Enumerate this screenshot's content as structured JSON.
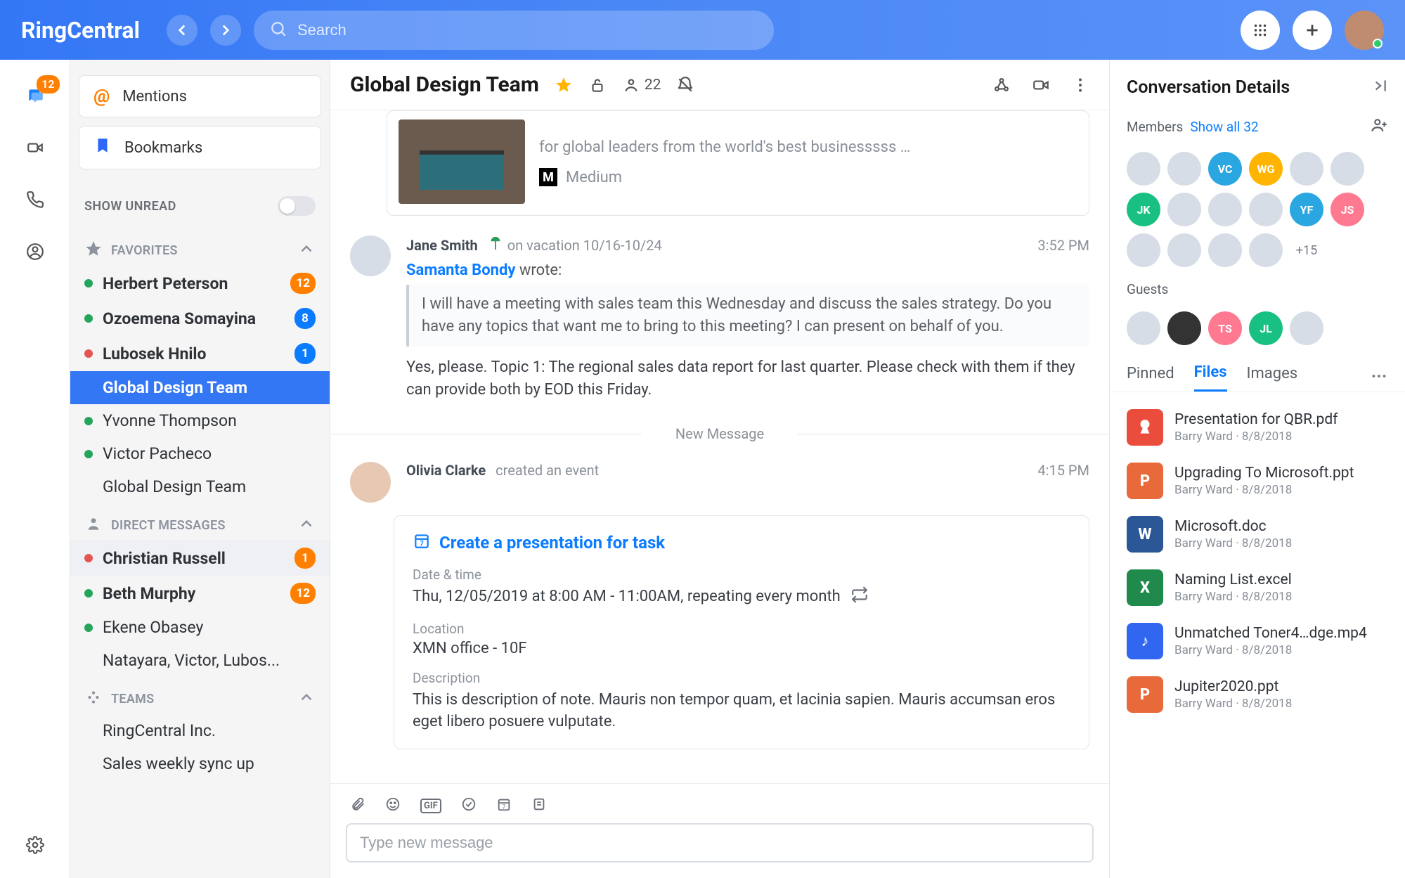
{
  "brand": "RingCentral",
  "search": {
    "placeholder": "Search"
  },
  "rail": {
    "messages_badge": "12"
  },
  "sidebar": {
    "mentions": "Mentions",
    "bookmarks": "Bookmarks",
    "show_unread": "SHOW UNREAD",
    "favorites_label": "FAVORITES",
    "dm_label": "DIRECT MESSAGES",
    "teams_label": "TEAMS",
    "favorites": [
      {
        "name": "Herbert Peterson",
        "dot": "green",
        "badge": "12",
        "badge_color": "orange",
        "unread": true
      },
      {
        "name": "Ozoemena Somayina",
        "dot": "green",
        "badge": "8",
        "badge_color": "blue",
        "unread": true
      },
      {
        "name": "Lubosek Hnilo",
        "dot": "red",
        "badge": "1",
        "badge_color": "blue",
        "unread": true
      },
      {
        "name": "Global Design Team",
        "dot": "none",
        "active": true,
        "unread": true
      },
      {
        "name": "Yvonne Thompson",
        "dot": "green"
      },
      {
        "name": "Victor Pacheco",
        "dot": "green"
      },
      {
        "name": "Global Design Team",
        "dot": "none"
      }
    ],
    "dms": [
      {
        "name": "Christian Russell",
        "dot": "red",
        "badge": "1",
        "badge_color": "orange",
        "unread": true,
        "highlight": true
      },
      {
        "name": "Beth Murphy",
        "dot": "green",
        "badge": "12",
        "badge_color": "orange",
        "unread": true
      },
      {
        "name": "Ekene Obasey",
        "dot": "green"
      },
      {
        "name": "Natayara, Victor, Lubos...",
        "dot": "none"
      }
    ],
    "teams": [
      {
        "name": "RingCentral Inc."
      },
      {
        "name": "Sales weekly sync up"
      }
    ]
  },
  "header": {
    "title": "Global Design Team",
    "member_count": "22"
  },
  "preview": {
    "text": "for global leaders from the world's best businesssss …",
    "source": "Medium"
  },
  "msg1": {
    "author": "Jane Smith",
    "status": "on vacation 10/16-10/24",
    "time": "3:52 PM",
    "quote_author": "Samanta Bondy",
    "quote_wrote": " wrote:",
    "quote": "I will have a meeting with sales team this Wednesday and discuss the sales strategy.  Do you have any topics that want me to bring to this meeting? I can present on behalf of you.",
    "reply": "Yes, please.  Topic 1: The regional sales data report for last quarter.  Please check with them if they can provide both by EOD this Friday."
  },
  "new_msg_divider": "New Message",
  "msg2": {
    "author": "Olivia Clarke",
    "action": "created an event",
    "time": "4:15 PM",
    "event_title": "Create a presentation for task",
    "labels": {
      "datetime": "Date & time",
      "location": "Location",
      "desc": "Description"
    },
    "datetime": "Thu, 12/05/2019 at 8:00 AM - 11:00AM, repeating every month",
    "location": "XMN office - 10F",
    "desc": "This is description of note. Mauris non tempor quam, et lacinia sapien. Mauris accumsan eros eget libero posuere vulputate."
  },
  "composer": {
    "placeholder": "Type new message"
  },
  "details": {
    "title": "Conversation Details",
    "members_label": "Members",
    "show_all": "Show all 32",
    "plus_count": "+15",
    "guests_label": "Guests",
    "tabs": {
      "pinned": "Pinned",
      "files": "Files",
      "images": "Images"
    },
    "files": [
      {
        "name": "Presentation for QBR.pdf",
        "meta": "Barry Ward  ·  8/8/2018",
        "kind": "pdf",
        "glyph": ""
      },
      {
        "name": "Upgrading To Microsoft.ppt",
        "meta": "Barry Ward  ·  8/8/2018",
        "kind": "ppt",
        "glyph": "P"
      },
      {
        "name": "Microsoft.doc",
        "meta": "Barry Ward  ·  8/8/2018",
        "kind": "doc",
        "glyph": "W"
      },
      {
        "name": "Naming List.excel",
        "meta": "Barry Ward  ·  8/8/2018",
        "kind": "xls",
        "glyph": "X"
      },
      {
        "name": "Unmatched Toner4…dge.mp4",
        "meta": "Barry Ward  ·  8/8/2018",
        "kind": "mp4",
        "glyph": "♪"
      },
      {
        "name": "Jupiter2020.ppt",
        "meta": "Barry Ward  ·  8/8/2018",
        "kind": "ppt",
        "glyph": "P"
      }
    ]
  }
}
